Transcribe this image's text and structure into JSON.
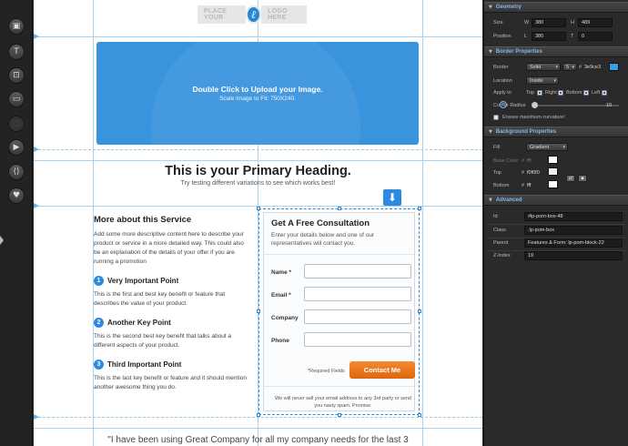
{
  "tools": [
    {
      "name": "tool-image-icon",
      "glyph": "▣"
    },
    {
      "name": "tool-text-icon",
      "glyph": "T"
    },
    {
      "name": "tool-form-icon",
      "glyph": "⊡"
    },
    {
      "name": "tool-button-icon",
      "glyph": "▭"
    },
    {
      "name": "tool-disabled-icon",
      "glyph": "◌"
    },
    {
      "name": "tool-video-icon",
      "glyph": "▶"
    },
    {
      "name": "tool-code-icon",
      "glyph": "⟨⟩"
    },
    {
      "name": "tool-social-icon",
      "glyph": "♥"
    }
  ],
  "canvas": {
    "logo_left": "PLACE YOUR",
    "logo_right": "LOGO HERE",
    "logo_glyph": "ℓ",
    "upload_title": "Double Click to Upload your Image.",
    "upload_sub": "Scale Image to Fit: 750X240.",
    "primary_heading": "This is your Primary Heading.",
    "sub_heading": "Try testing different variations to see which works best!",
    "drop_arrow": "⬇",
    "left_title": "More about this Service",
    "left_desc": "Add some more descriptive content here to describe your product or service in a more detailed way. This could also be an explanation of the details of your offer if you are running a promotion",
    "points": [
      {
        "num": "1",
        "title": "Very Important Point",
        "body": "This is the first and best key benefit or feature that describes the value of your product."
      },
      {
        "num": "2",
        "title": "Another Key Point",
        "body": "This is the second best key benefit that talks about a different aspects of your product."
      },
      {
        "num": "3",
        "title": "Third Important Point",
        "body": "This is the last key benefit or feature and it should mention another awesome thing you do."
      }
    ],
    "form": {
      "title": "Get A Free Consultation",
      "intro": "Enter your details below and one of our representatives will contact you.",
      "fields": [
        "Name *",
        "Email *",
        "Company",
        "Phone"
      ],
      "required_note": "*Required Fields",
      "button": "Contact Me",
      "privacy": "We will never sell your email address to any 3rd party or send you nasty spam. Promise."
    },
    "testimonial": "\"I have been using Great Company for all my company needs for the last 3"
  },
  "panel": {
    "geometry": {
      "title": "Geometry",
      "size_label": "Size",
      "w_label": "W",
      "w_value": "380",
      "h_label": "H",
      "h_value": "489",
      "position_label": "Position",
      "l_label": "L",
      "l_value": "380",
      "t_label": "T",
      "t_value": "0"
    },
    "border": {
      "title": "Border Properties",
      "border_label": "Border",
      "style": "Solid",
      "width": "5",
      "hash": "#",
      "color": "3e9ce3",
      "location_label": "Location",
      "location": "Inside",
      "apply_label": "Apply to",
      "top": "Top",
      "right": "Right",
      "bottom": "Bottom",
      "left": "Left",
      "radius_label": "Corner Radius",
      "radius_value": "10",
      "ensure": "Ensure maximum curvature!"
    },
    "background": {
      "title": "Background Properties",
      "fill_label": "Fill",
      "fill": "Gradient",
      "base_label": "Base Color",
      "base_value": "fff",
      "top_label": "Top",
      "top_value": "f0f0f0",
      "bottom_label": "Bottom",
      "bottom_value": "fff",
      "hash": "#"
    },
    "advanced": {
      "title": "Advanced",
      "id_label": "Id",
      "id_value": "#lp-pom-box-48",
      "class_label": "Class",
      "class_value": ".lp-pom-box",
      "parent_label": "Parent",
      "parent_value": "Features & Form: lp-pom-block-22",
      "z_label": "Z-Index",
      "z_value": "19"
    }
  },
  "colors": {
    "accent": "#2c8ae0",
    "border_swatch": "#3e9ce3",
    "button": "#e8741c"
  }
}
